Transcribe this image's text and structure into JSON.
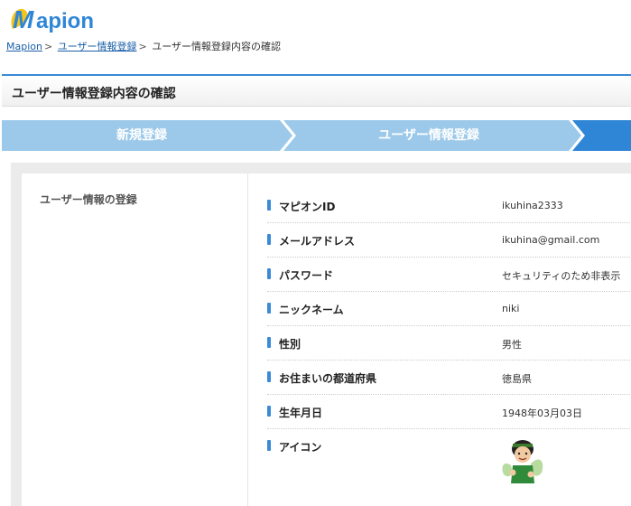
{
  "header": {
    "logo_text": "Mapion"
  },
  "breadcrumb": {
    "items": [
      {
        "label": "Mapion"
      },
      {
        "label": "ユーザー情報登録"
      },
      {
        "label": "ユーザー情報登録内容の確認"
      }
    ]
  },
  "page": {
    "title": "ユーザー情報登録内容の確認"
  },
  "steps": [
    {
      "label": "新規登録"
    },
    {
      "label": "ユーザー情報登録"
    },
    {
      "label": ""
    }
  ],
  "colors": {
    "accent": "#3a8ad6",
    "step_inactive": "#9cc9ea",
    "step_active": "#2f86d6",
    "link": "#1a5fa8"
  },
  "form": {
    "section_label": "ユーザー情報の登録",
    "fields": [
      {
        "label": "マピオンID",
        "value": "ikuhina2333"
      },
      {
        "label": "メールアドレス",
        "value": "ikuhina@gmail.com"
      },
      {
        "label": "パスワード",
        "value": "セキュリティのため非表示"
      },
      {
        "label": "ニックネーム",
        "value": "niki"
      },
      {
        "label": "性別",
        "value": "男性"
      },
      {
        "label": "お住まいの都道府県",
        "value": "徳島県"
      },
      {
        "label": "生年月日",
        "value": "1948年03月03日"
      },
      {
        "label": "アイコン",
        "value": ""
      }
    ],
    "icon_name": "cartoon-avatar-icon"
  }
}
